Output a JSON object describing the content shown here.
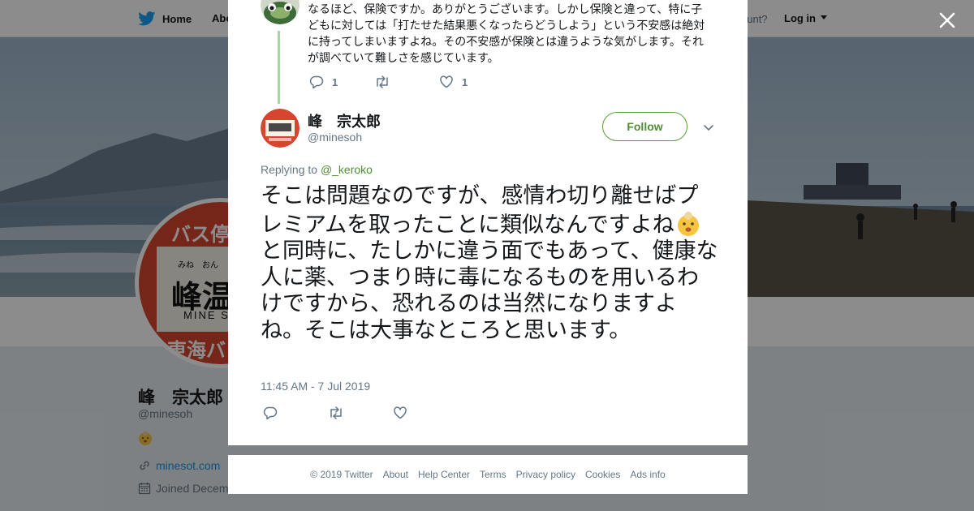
{
  "topbar": {
    "home_label": "Home",
    "about_label": "Abo",
    "have_account_text": "ccount?",
    "login_label": "Log in"
  },
  "profile": {
    "avatar_sign": {
      "top": "バス停",
      "reading": "みね　おん",
      "main": "峰温",
      "roman": "MINE S",
      "bottom": "東海バ"
    },
    "name": "峰　宗太郎",
    "handle": "@minesoh",
    "website": "minesot.com",
    "joined_text": "Joined Decem"
  },
  "previous_tweet": {
    "text": "なるほど、保険ですか。ありがとうございます。しかし保険と違って、特に子どもに対しては「打たせた結果悪くなったらどうしよう」という不安感は絶対に持ってしまいますよね。その不安感が保険とは違うような気がします。それが調べていて難しさを感じています。",
    "reply_count": "1",
    "like_count": "1"
  },
  "tweet": {
    "author_name": "峰　宗太郎",
    "author_handle": "@minesoh",
    "follow_label": "Follow",
    "replying_to_prefix": "Replying to",
    "replying_to_handle": "@_keroko",
    "text_part1": "そこは問題なのですが、感情わ切り離せばプレミアムを取ったことに類似なんですよね",
    "text_part2": "と同時に、たしかに違う面でもあって、健康な人に薬、つまり時に毒になるものを用いるわけですから、恐れるのは当然になりますよね。そこは大事なところと思います。",
    "timestamp": "11:45 AM - 7 Jul 2019"
  },
  "footer": {
    "copyright": "© 2019 Twitter",
    "links": [
      "About",
      "Help Center",
      "Terms",
      "Privacy policy",
      "Cookies",
      "Ads info"
    ]
  },
  "icons": {
    "brand": "twitter-bird-icon",
    "close": "close-icon",
    "reply": "reply-icon",
    "retweet": "retweet-icon",
    "like": "heart-icon",
    "caret": "chevron-down-icon",
    "link": "link-icon",
    "calendar": "calendar-icon",
    "emoji": "face-emoji-icon"
  },
  "colors": {
    "brand_blue": "#1da1f2",
    "follow_green": "#4d8f32",
    "thread_line": "#a6d6a6",
    "muted_text": "#657786"
  }
}
